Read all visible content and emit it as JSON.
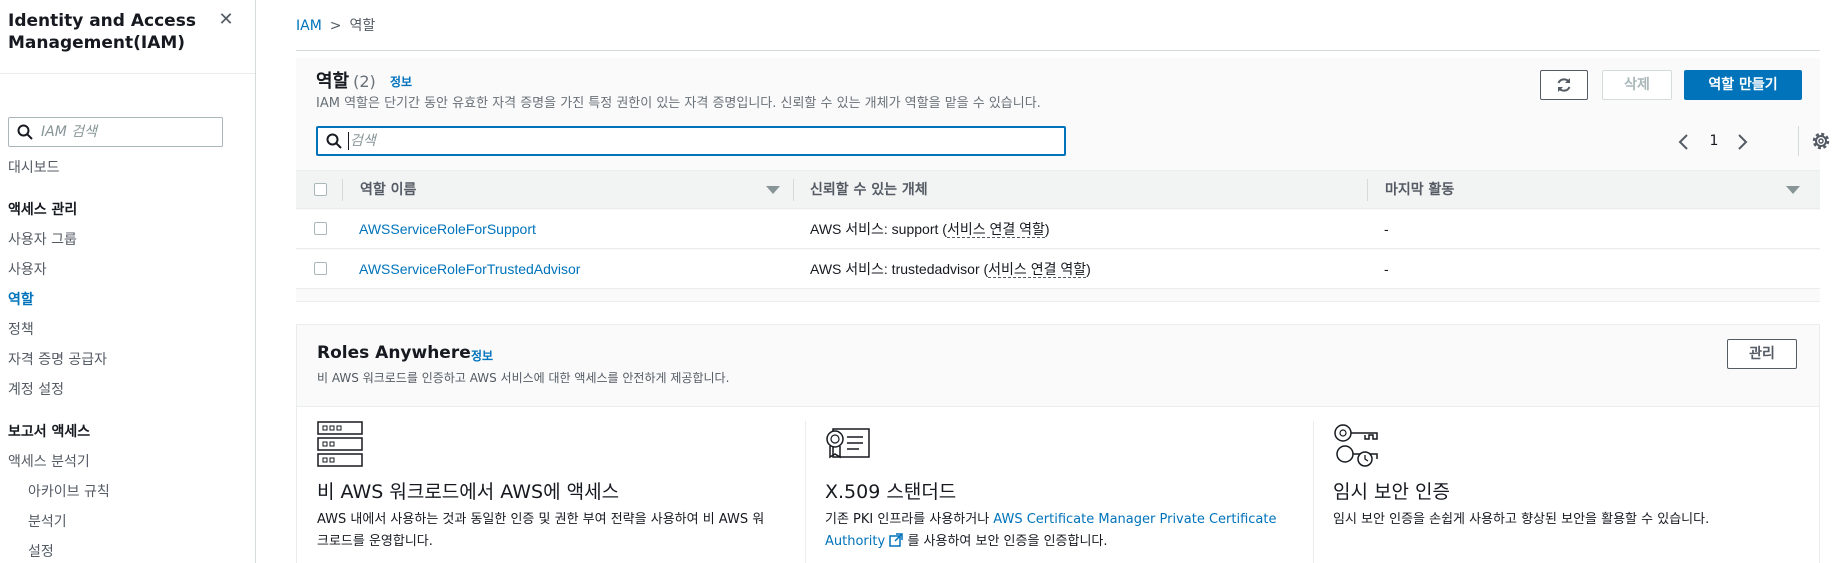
{
  "sidebar": {
    "title": "Identity and Access Management(IAM)",
    "close_icon": "close-icon",
    "search_placeholder": "IAM 검색",
    "items": [
      {
        "label": "대시보드"
      },
      {
        "label": "액세스 관리"
      },
      {
        "label": "사용자 그룹"
      },
      {
        "label": "사용자"
      },
      {
        "label": "역할"
      },
      {
        "label": "정책"
      },
      {
        "label": "자격 증명 공급자"
      },
      {
        "label": "계정 설정"
      },
      {
        "label": "보고서 액세스"
      },
      {
        "label": "액세스 분석기"
      },
      {
        "label": "아카이브 규칙"
      },
      {
        "label": "분석기"
      },
      {
        "label": "설정"
      }
    ]
  },
  "breadcrumb": {
    "root": "IAM",
    "current": "역할"
  },
  "roles": {
    "title": "역할",
    "count": "(2)",
    "info": "정보",
    "description": "IAM 역할은 단기간 동안 유효한 자격 증명을 가진 특정 권한이 있는 자격 증명입니다. 신뢰할 수 있는 개체가 역할을 맡을 수 있습니다.",
    "delete_label": "삭제",
    "create_label": "역할 만들기",
    "search_placeholder": "검색",
    "page": "1",
    "columns": {
      "name": "역할 이름",
      "trusted": "신뢰할 수 있는 개체",
      "last_activity": "마지막 활동"
    },
    "rows": [
      {
        "name": "AWSServiceRoleForSupport",
        "trusted_prefix": "AWS 서비스: support (",
        "trusted_link": "서비스 연결 역할",
        "trusted_suffix": ")",
        "last_activity": "-"
      },
      {
        "name": "AWSServiceRoleForTrustedAdvisor",
        "trusted_prefix": "AWS 서비스: trustedadvisor (",
        "trusted_link": "서비스 연결 역할",
        "trusted_suffix": ")",
        "last_activity": "-"
      }
    ]
  },
  "roles_anywhere": {
    "title": "Roles Anywhere",
    "info": "정보",
    "description": "비 AWS 워크로드를 인증하고 AWS 서비스에 대한 액세스를 안전하게 제공합니다.",
    "manage_label": "관리",
    "features": [
      {
        "icon": "server-rack-icon",
        "heading": "비 AWS 워크로드에서 AWS에 액세스",
        "text": "AWS 내에서 사용하는 것과 동일한 인증 및 권한 부여 전략을 사용하여 비 AWS 워크로드를 운영합니다."
      },
      {
        "icon": "certificate-icon",
        "heading": "X.509 스탠더드",
        "text_prefix": "기존 PKI 인프라를 사용하거나 ",
        "link": "AWS Certificate Manager Private Certificate Authority",
        "text_suffix": " 를 사용하여 보안 인증을 인증합니다."
      },
      {
        "icon": "temporary-key-icon",
        "heading": "임시 보안 인증",
        "text": "임시 보안 인증을 손쉽게 사용하고 향상된 보안을 활용할 수 있습니다."
      }
    ]
  },
  "colors": {
    "link": "#0073bb",
    "primary_button": "#0073bb",
    "header_bg": "#f2f3f3"
  }
}
